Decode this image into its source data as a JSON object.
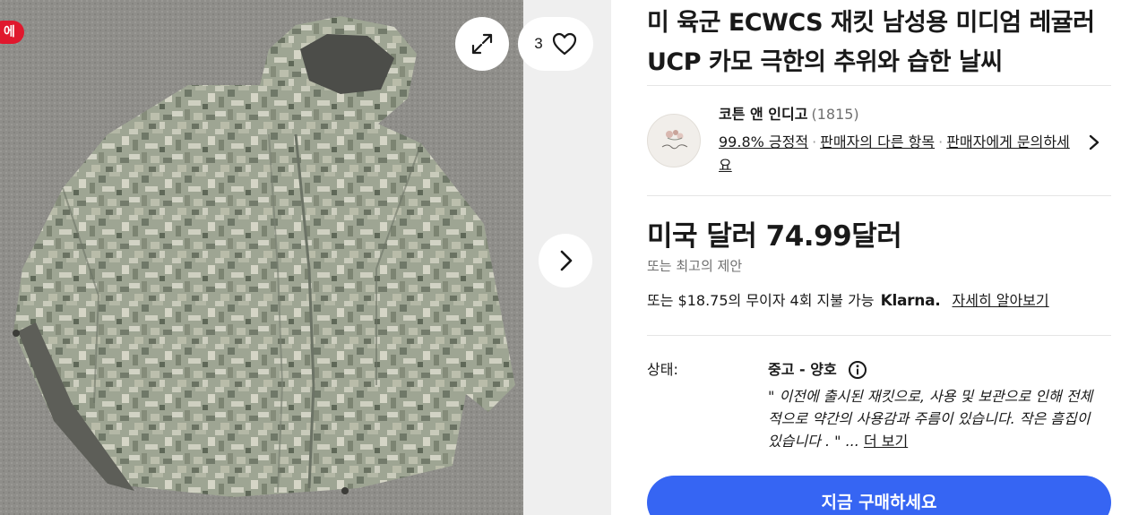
{
  "gallery": {
    "badge": "에",
    "favorite_count": "3",
    "icons": {
      "expand": "expand-icon",
      "favorite": "heart-icon",
      "next": "chevron-right-icon"
    }
  },
  "listing": {
    "title": "미 육군 ECWCS 재킷 남성용 미디엄 레귤러 UCP 카모 극한의 추위와 습한 날씨"
  },
  "seller": {
    "name": "코튼 앤 인디고",
    "feedback_count": "(1815)",
    "positive": "99.8% 긍정적",
    "other_items": "판매자의 다른 항목",
    "contact": "판매자에게 문의하세요"
  },
  "pricing": {
    "price": "미국 달러 74.99달러",
    "best_offer": "또는 최고의 제안",
    "installment_prefix": "또는 $18.75의 무이자 4회 지불 가능",
    "klarna": "Klarna.",
    "learn_more": "자세히 알아보기"
  },
  "condition": {
    "label": "상태:",
    "value": "중고 - 양호",
    "description": "\" 이전에 출시된 재킷으로, 사용 및 보관으로 인해 전체적으로 약간의 사용감과 주름이 있습니다. 작은 흠집이 있습니다 . \" ...",
    "see_more": "더 보기"
  },
  "actions": {
    "buy_now": "지금 구매하세요"
  },
  "colors": {
    "accent_blue": "#3665f3",
    "badge_red": "#e0182d",
    "text": "#191919",
    "muted": "#707070"
  }
}
